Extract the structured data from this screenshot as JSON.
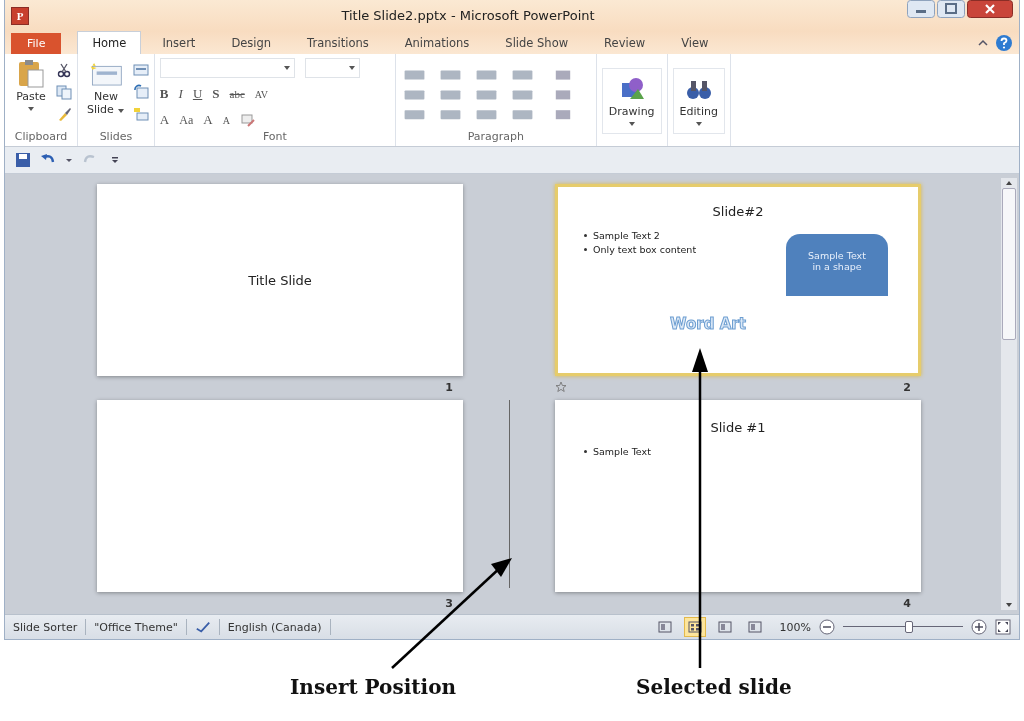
{
  "window": {
    "title": "Title Slide2.pptx - Microsoft PowerPoint",
    "app_icon": "P"
  },
  "tabs": [
    {
      "label": "File",
      "selected": false,
      "kind": "file"
    },
    {
      "label": "Home",
      "selected": true,
      "kind": "tab"
    },
    {
      "label": "Insert",
      "selected": false,
      "kind": "tab"
    },
    {
      "label": "Design",
      "selected": false,
      "kind": "tab"
    },
    {
      "label": "Transitions",
      "selected": false,
      "kind": "tab"
    },
    {
      "label": "Animations",
      "selected": false,
      "kind": "tab"
    },
    {
      "label": "Slide Show",
      "selected": false,
      "kind": "tab"
    },
    {
      "label": "Review",
      "selected": false,
      "kind": "tab"
    },
    {
      "label": "View",
      "selected": false,
      "kind": "tab"
    }
  ],
  "ribbon": {
    "clipboard": {
      "label": "Clipboard",
      "paste": "Paste"
    },
    "slides": {
      "label": "Slides",
      "new_slide": [
        "New",
        "Slide"
      ]
    },
    "font": {
      "label": "Font",
      "row_1": [
        "B",
        "I",
        "U",
        "S",
        "abc",
        "AV"
      ],
      "row_2": [
        "A",
        "Aa",
        "A",
        "A"
      ]
    },
    "paragraph": {
      "label": "Paragraph"
    },
    "drawing": {
      "label": "Drawing"
    },
    "editing": {
      "label": "Editing"
    }
  },
  "slides": [
    {
      "number": "1",
      "selected": false,
      "insert_before": false,
      "transition": false,
      "title": "Title Slide",
      "kind": "title"
    },
    {
      "number": "2",
      "selected": true,
      "insert_before": false,
      "transition": true,
      "title": "Slide#2",
      "kind": "content",
      "bullets": [
        "Sample Text 2",
        "Only text box content"
      ],
      "shape_text": "Sample Text in a shape",
      "word_art": "Word Art"
    },
    {
      "number": "3",
      "selected": false,
      "insert_before": false,
      "transition": false,
      "kind": "blank"
    },
    {
      "number": "4",
      "selected": false,
      "insert_before": true,
      "transition": false,
      "title": "Slide #1",
      "kind": "content",
      "bullets": [
        "Sample Text"
      ]
    }
  ],
  "status_bar": {
    "items": [
      "Slide Sorter",
      "\"Office Theme\""
    ],
    "language": "English (Canada)",
    "views": [
      {
        "selected": false
      },
      {
        "selected": true
      },
      {
        "selected": false
      },
      {
        "selected": false
      }
    ],
    "zoom": "100%",
    "zoom_slider": {
      "level": 0.55
    }
  },
  "annotations": [
    {
      "label": "Insert Position",
      "kind": "insert"
    },
    {
      "label": "Selected slide",
      "kind": "selected"
    }
  ]
}
